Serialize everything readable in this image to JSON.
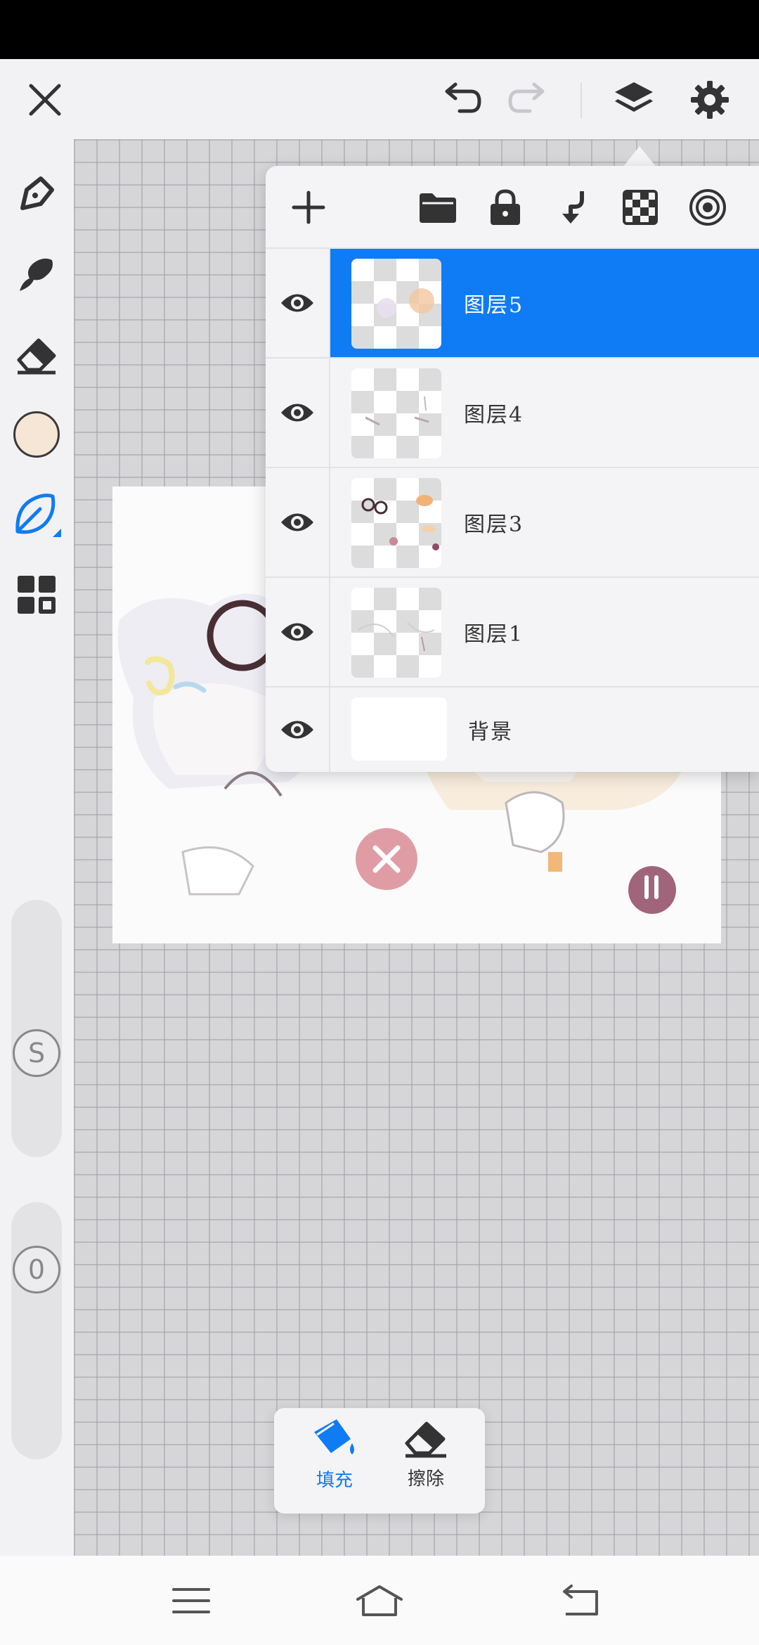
{
  "toolbar": {
    "close_icon": "close-icon",
    "undo_icon": "undo-icon",
    "redo_icon": "redo-icon",
    "layers_icon": "layers-icon",
    "settings_icon": "gear-icon"
  },
  "left_tools": {
    "items": [
      "pencil-icon",
      "smudge-brush-icon",
      "eraser-icon",
      "color-swatch",
      "fill-leaf-icon",
      "grid-menu-icon"
    ],
    "current_color": "#f6e6d6",
    "active_tool_color": "#0f7bf5",
    "size_slider_label": "S",
    "opacity_slider_label": "0"
  },
  "layers_panel": {
    "toolbar_icons": [
      "add-icon",
      "folder-icon",
      "lock-icon",
      "merge-down-icon",
      "transparency-icon",
      "blend-icon"
    ],
    "layers": [
      {
        "name": "图层5",
        "visible": true,
        "selected": true
      },
      {
        "name": "图层4",
        "visible": true,
        "selected": false
      },
      {
        "name": "图层3",
        "visible": true,
        "selected": false
      },
      {
        "name": "图层1",
        "visible": true,
        "selected": false
      },
      {
        "name": "背景",
        "visible": true,
        "selected": false
      }
    ]
  },
  "bottom_popup": {
    "fill_label": "填充",
    "erase_label": "擦除",
    "fill_color": "#0f7bf5"
  },
  "nav": {
    "menu_icon": "menu-icon",
    "home_icon": "home-icon",
    "back_icon": "back-icon"
  }
}
